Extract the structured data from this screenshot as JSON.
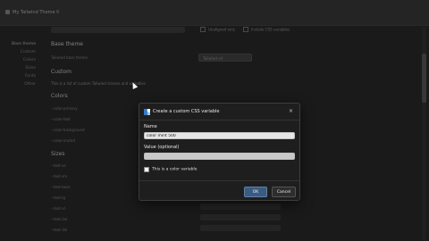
{
  "window": {
    "title": "My Tailwind Theme",
    "close_glyph": "×"
  },
  "toolbar": {
    "checkbox_1": "Unaligned only",
    "checkbox_2": "Include CSS variables"
  },
  "sidebar": {
    "items": [
      {
        "label": "Base theme",
        "active": true
      },
      {
        "label": "Custom"
      },
      {
        "label": "Colors"
      },
      {
        "label": "Sizes"
      },
      {
        "label": "Fonts"
      },
      {
        "label": "Other"
      }
    ]
  },
  "main": {
    "base_theme_title": "Base theme",
    "tailwind_row_label": "Tailwind base theme",
    "dropdown_value": "Tailwind v4",
    "custom_title": "Custom",
    "custom_hint": "This is a list of custom Tailwind classes and variables",
    "colors_title": "Colors",
    "color_lines": [
      "--color-primary",
      "--color-text",
      "--color-background",
      "--color-muted"
    ],
    "sizes_title": "Sizes",
    "size_lines": [
      "--text-xs",
      "--text-sm",
      "--text-base",
      "--text-lg",
      "--text-xl",
      "--text-2xl",
      "--text-3xl"
    ]
  },
  "modal": {
    "title": "Create a custom CSS variable",
    "close_glyph": "×",
    "name_label": "Name",
    "name_value": "color mint 500",
    "value_label": "Value (optional)",
    "value_value": "",
    "checkbox_label": "This is a color variable",
    "ok_label": "OK",
    "cancel_label": "Cancel"
  },
  "colors": {
    "accent": "#3b5b7f",
    "modal_bg": "#1e1e1e",
    "page_bg": "#2a2a2a"
  }
}
